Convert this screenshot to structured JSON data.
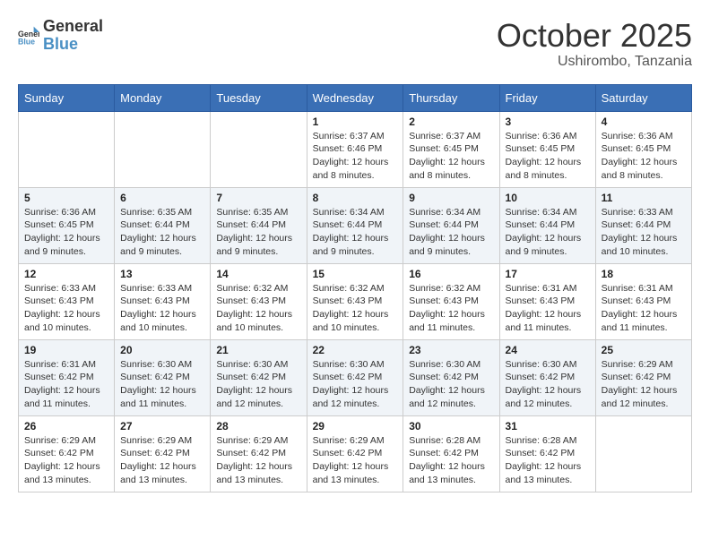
{
  "header": {
    "logo_general": "General",
    "logo_blue": "Blue",
    "month": "October 2025",
    "location": "Ushirombo, Tanzania"
  },
  "days_of_week": [
    "Sunday",
    "Monday",
    "Tuesday",
    "Wednesday",
    "Thursday",
    "Friday",
    "Saturday"
  ],
  "weeks": [
    [
      {
        "day": "",
        "sunrise": "",
        "sunset": "",
        "daylight": ""
      },
      {
        "day": "",
        "sunrise": "",
        "sunset": "",
        "daylight": ""
      },
      {
        "day": "",
        "sunrise": "",
        "sunset": "",
        "daylight": ""
      },
      {
        "day": "1",
        "sunrise": "Sunrise: 6:37 AM",
        "sunset": "Sunset: 6:46 PM",
        "daylight": "Daylight: 12 hours and 8 minutes."
      },
      {
        "day": "2",
        "sunrise": "Sunrise: 6:37 AM",
        "sunset": "Sunset: 6:45 PM",
        "daylight": "Daylight: 12 hours and 8 minutes."
      },
      {
        "day": "3",
        "sunrise": "Sunrise: 6:36 AM",
        "sunset": "Sunset: 6:45 PM",
        "daylight": "Daylight: 12 hours and 8 minutes."
      },
      {
        "day": "4",
        "sunrise": "Sunrise: 6:36 AM",
        "sunset": "Sunset: 6:45 PM",
        "daylight": "Daylight: 12 hours and 8 minutes."
      }
    ],
    [
      {
        "day": "5",
        "sunrise": "Sunrise: 6:36 AM",
        "sunset": "Sunset: 6:45 PM",
        "daylight": "Daylight: 12 hours and 9 minutes."
      },
      {
        "day": "6",
        "sunrise": "Sunrise: 6:35 AM",
        "sunset": "Sunset: 6:44 PM",
        "daylight": "Daylight: 12 hours and 9 minutes."
      },
      {
        "day": "7",
        "sunrise": "Sunrise: 6:35 AM",
        "sunset": "Sunset: 6:44 PM",
        "daylight": "Daylight: 12 hours and 9 minutes."
      },
      {
        "day": "8",
        "sunrise": "Sunrise: 6:34 AM",
        "sunset": "Sunset: 6:44 PM",
        "daylight": "Daylight: 12 hours and 9 minutes."
      },
      {
        "day": "9",
        "sunrise": "Sunrise: 6:34 AM",
        "sunset": "Sunset: 6:44 PM",
        "daylight": "Daylight: 12 hours and 9 minutes."
      },
      {
        "day": "10",
        "sunrise": "Sunrise: 6:34 AM",
        "sunset": "Sunset: 6:44 PM",
        "daylight": "Daylight: 12 hours and 9 minutes."
      },
      {
        "day": "11",
        "sunrise": "Sunrise: 6:33 AM",
        "sunset": "Sunset: 6:44 PM",
        "daylight": "Daylight: 12 hours and 10 minutes."
      }
    ],
    [
      {
        "day": "12",
        "sunrise": "Sunrise: 6:33 AM",
        "sunset": "Sunset: 6:43 PM",
        "daylight": "Daylight: 12 hours and 10 minutes."
      },
      {
        "day": "13",
        "sunrise": "Sunrise: 6:33 AM",
        "sunset": "Sunset: 6:43 PM",
        "daylight": "Daylight: 12 hours and 10 minutes."
      },
      {
        "day": "14",
        "sunrise": "Sunrise: 6:32 AM",
        "sunset": "Sunset: 6:43 PM",
        "daylight": "Daylight: 12 hours and 10 minutes."
      },
      {
        "day": "15",
        "sunrise": "Sunrise: 6:32 AM",
        "sunset": "Sunset: 6:43 PM",
        "daylight": "Daylight: 12 hours and 10 minutes."
      },
      {
        "day": "16",
        "sunrise": "Sunrise: 6:32 AM",
        "sunset": "Sunset: 6:43 PM",
        "daylight": "Daylight: 12 hours and 11 minutes."
      },
      {
        "day": "17",
        "sunrise": "Sunrise: 6:31 AM",
        "sunset": "Sunset: 6:43 PM",
        "daylight": "Daylight: 12 hours and 11 minutes."
      },
      {
        "day": "18",
        "sunrise": "Sunrise: 6:31 AM",
        "sunset": "Sunset: 6:43 PM",
        "daylight": "Daylight: 12 hours and 11 minutes."
      }
    ],
    [
      {
        "day": "19",
        "sunrise": "Sunrise: 6:31 AM",
        "sunset": "Sunset: 6:42 PM",
        "daylight": "Daylight: 12 hours and 11 minutes."
      },
      {
        "day": "20",
        "sunrise": "Sunrise: 6:30 AM",
        "sunset": "Sunset: 6:42 PM",
        "daylight": "Daylight: 12 hours and 11 minutes."
      },
      {
        "day": "21",
        "sunrise": "Sunrise: 6:30 AM",
        "sunset": "Sunset: 6:42 PM",
        "daylight": "Daylight: 12 hours and 12 minutes."
      },
      {
        "day": "22",
        "sunrise": "Sunrise: 6:30 AM",
        "sunset": "Sunset: 6:42 PM",
        "daylight": "Daylight: 12 hours and 12 minutes."
      },
      {
        "day": "23",
        "sunrise": "Sunrise: 6:30 AM",
        "sunset": "Sunset: 6:42 PM",
        "daylight": "Daylight: 12 hours and 12 minutes."
      },
      {
        "day": "24",
        "sunrise": "Sunrise: 6:30 AM",
        "sunset": "Sunset: 6:42 PM",
        "daylight": "Daylight: 12 hours and 12 minutes."
      },
      {
        "day": "25",
        "sunrise": "Sunrise: 6:29 AM",
        "sunset": "Sunset: 6:42 PM",
        "daylight": "Daylight: 12 hours and 12 minutes."
      }
    ],
    [
      {
        "day": "26",
        "sunrise": "Sunrise: 6:29 AM",
        "sunset": "Sunset: 6:42 PM",
        "daylight": "Daylight: 12 hours and 13 minutes."
      },
      {
        "day": "27",
        "sunrise": "Sunrise: 6:29 AM",
        "sunset": "Sunset: 6:42 PM",
        "daylight": "Daylight: 12 hours and 13 minutes."
      },
      {
        "day": "28",
        "sunrise": "Sunrise: 6:29 AM",
        "sunset": "Sunset: 6:42 PM",
        "daylight": "Daylight: 12 hours and 13 minutes."
      },
      {
        "day": "29",
        "sunrise": "Sunrise: 6:29 AM",
        "sunset": "Sunset: 6:42 PM",
        "daylight": "Daylight: 12 hours and 13 minutes."
      },
      {
        "day": "30",
        "sunrise": "Sunrise: 6:28 AM",
        "sunset": "Sunset: 6:42 PM",
        "daylight": "Daylight: 12 hours and 13 minutes."
      },
      {
        "day": "31",
        "sunrise": "Sunrise: 6:28 AM",
        "sunset": "Sunset: 6:42 PM",
        "daylight": "Daylight: 12 hours and 13 minutes."
      },
      {
        "day": "",
        "sunrise": "",
        "sunset": "",
        "daylight": ""
      }
    ]
  ]
}
